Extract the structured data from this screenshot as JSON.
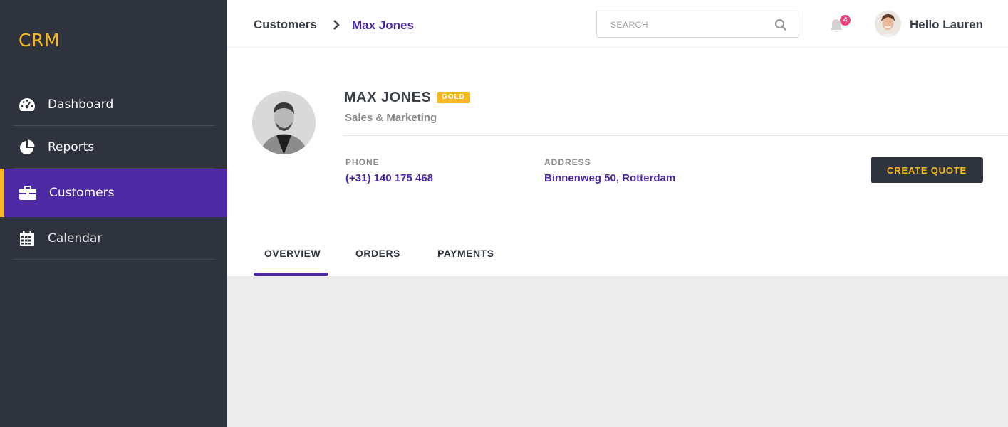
{
  "app": {
    "logo": "CRM"
  },
  "sidebar": {
    "items": [
      {
        "label": "Dashboard",
        "icon": "dashboard-gauge-icon"
      },
      {
        "label": "Reports",
        "icon": "pie-chart-icon"
      },
      {
        "label": "Customers",
        "icon": "briefcase-icon",
        "active": true
      },
      {
        "label": "Calendar",
        "icon": "calendar-icon"
      }
    ]
  },
  "header": {
    "breadcrumb": [
      "Customers",
      "Max Jones"
    ],
    "search_placeholder": "SEARCH",
    "notification_count": "4",
    "greeting": "Hello Lauren"
  },
  "customer": {
    "name": "MAX JONES",
    "tier": "GOLD",
    "department": "Sales & Marketing",
    "phone_label": "PHONE",
    "phone": "(+31) 140 175 468",
    "address_label": "ADDRESS",
    "address": "Binnenweg 50, Rotterdam",
    "action": "CREATE QUOTE"
  },
  "tabs": [
    {
      "label": "OVERVIEW",
      "active": true
    },
    {
      "label": "ORDERS"
    },
    {
      "label": "PAYMENTS"
    }
  ],
  "colors": {
    "sidebar_bg": "#2e333e",
    "accent_purple": "#4d2aa3",
    "accent_yellow": "#f6b81d",
    "badge_pink": "#e8457f",
    "content_bg": "#ececec"
  }
}
